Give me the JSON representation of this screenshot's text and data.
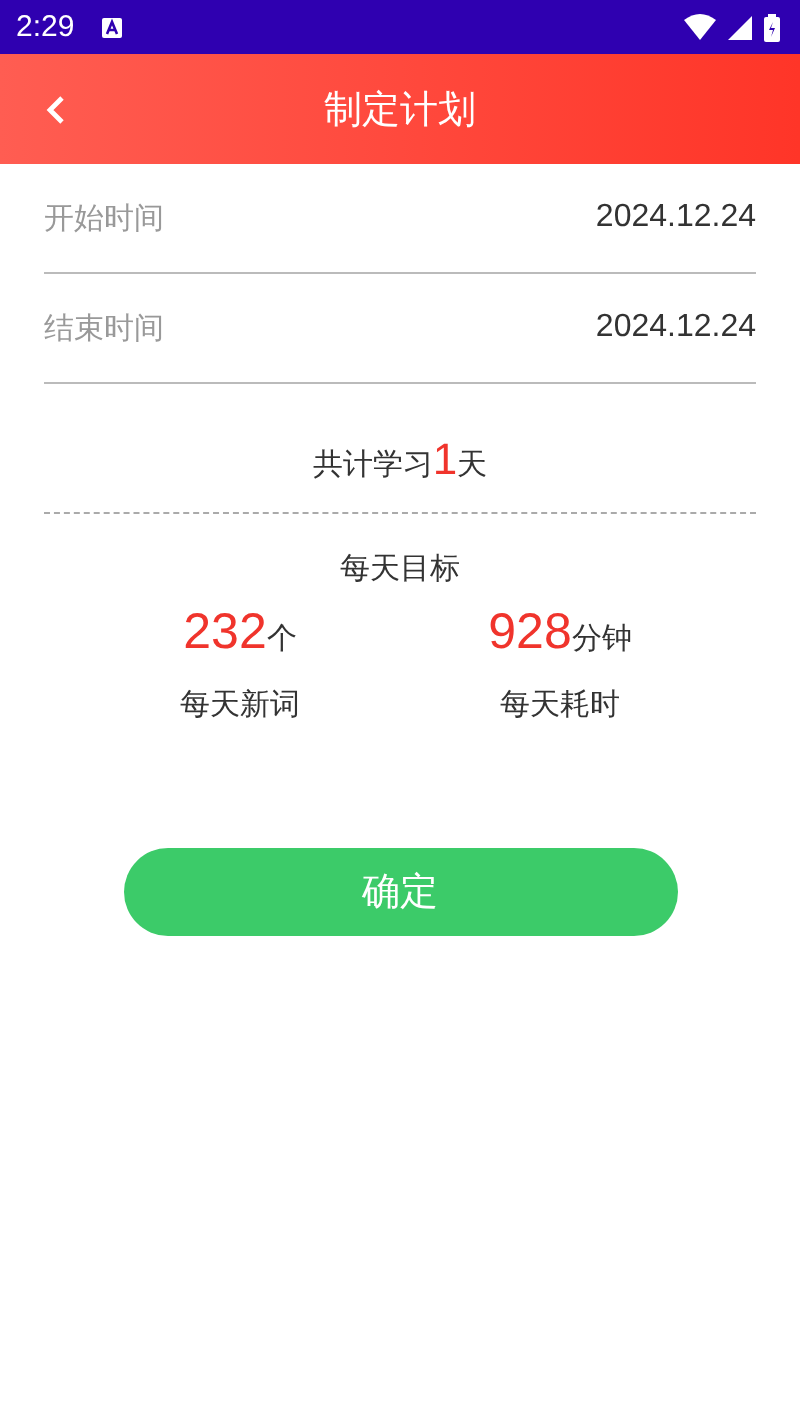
{
  "status_bar": {
    "time": "2:29"
  },
  "header": {
    "title": "制定计划"
  },
  "fields": [
    {
      "label": "开始时间",
      "value": "2024.12.24"
    },
    {
      "label": "结束时间",
      "value": "2024.12.24"
    }
  ],
  "total": {
    "prefix": "共计学习",
    "count": "1",
    "suffix": "天"
  },
  "daily_goal": {
    "title": "每天目标",
    "stats": [
      {
        "value": "232",
        "unit": "个",
        "label": "每天新词"
      },
      {
        "value": "928",
        "unit": "分钟",
        "label": "每天耗时"
      }
    ]
  },
  "confirm_button": {
    "label": "确定"
  }
}
